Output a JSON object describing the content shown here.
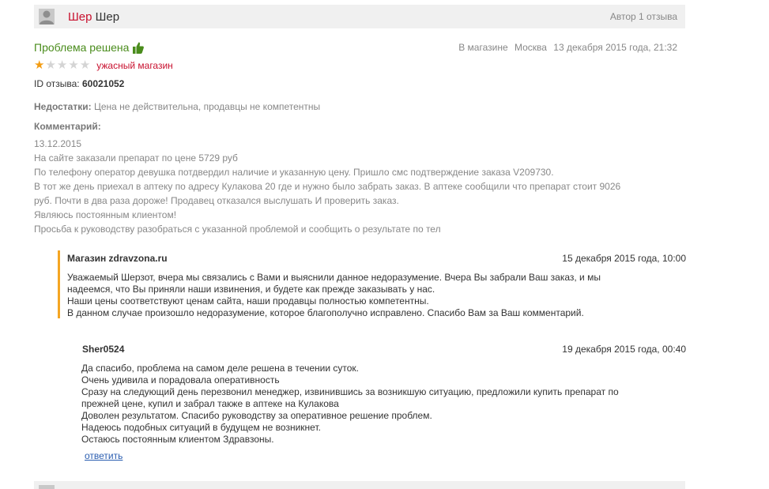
{
  "author": {
    "first_name": "Шер",
    "last_name": "Шер",
    "reviews_count": "Автор 1 отзыва"
  },
  "review": {
    "title": "Проблема решена",
    "where_label": "В магазине",
    "city": "Москва",
    "datetime": "13 декабря 2015 года, 21:32",
    "rating": 1,
    "rating_max": 5,
    "rating_text": "ужасный магазин",
    "id_label": "ID отзыва:",
    "id_value": "60021052",
    "cons_label": "Недостатки:",
    "cons_text": "Цена не действительна, продавцы не компетентны",
    "comment_label": "Комментарий:",
    "comment_lines": [
      "13.12.2015",
      "На сайте заказали препарат по цене 5729 руб",
      "По телефону оператор девушка потдвердил наличие и указанную цену. Пришло смс подтверждение заказа V209730.",
      "В тот же день приехал в аптеку по адресу Кулакова 20 где и нужно было забрать заказ. В аптеке сообщили что препарат стоит 9026",
      "руб. Почти в два раза дороже! Продавец отказался выслушать И проверить заказ.",
      "Являюсь постоянным клиентом!",
      "Просьба к руководству разобраться с указанной проблемой и сообщить о результате по тел"
    ]
  },
  "store_reply": {
    "author": "Магазин zdravzona.ru",
    "datetime": "15 декабря 2015 года, 10:00",
    "lines": [
      "Уважаемый Шерзот, вчера мы связались с Вами и выяснили данное недоразумение. Вчера Вы забрали Ваш заказ, и мы",
      "надеемся, что Вы приняли наши извинения, и будете как прежде заказывать у нас.",
      "Наши цены соответствуют ценам сайта, наши продавцы полностью компетентны.",
      "В данном случае произошло недоразумение, которое благополучно исправлено. Спасибо Вам за Ваш комментарий."
    ]
  },
  "user_reply": {
    "author": "Sher0524",
    "datetime": "19 декабря 2015 года, 00:40",
    "lines": [
      "Да спасибо, проблема на самом деле решена в течении суток.",
      "Очень удивила и порадовала оперативность",
      "Сразу на следующий день перезвонил менеджер, извинившись за возникшую ситуацию, предложили купить препарат по",
      "прежней цене, купил и забрал также в аптеке на Кулакова",
      "Доволен результатом. Спасибо руководству за оперативное решение проблем.",
      "Надеюсь подобных ситуаций в будущем не возникнет.",
      "Остаюсь постоянным клиентом Здравзоны."
    ],
    "reply_link": "ответить"
  },
  "icons": {
    "avatar": "user-avatar-icon",
    "thumb": "thumbs-up-icon",
    "star": "star-icon"
  },
  "colors": {
    "title_green": "#4a8c1c",
    "accent_red": "#c8102e",
    "star_on": "#f39c12",
    "reply_border": "#f5a623",
    "link_blue": "#2a5db0"
  }
}
